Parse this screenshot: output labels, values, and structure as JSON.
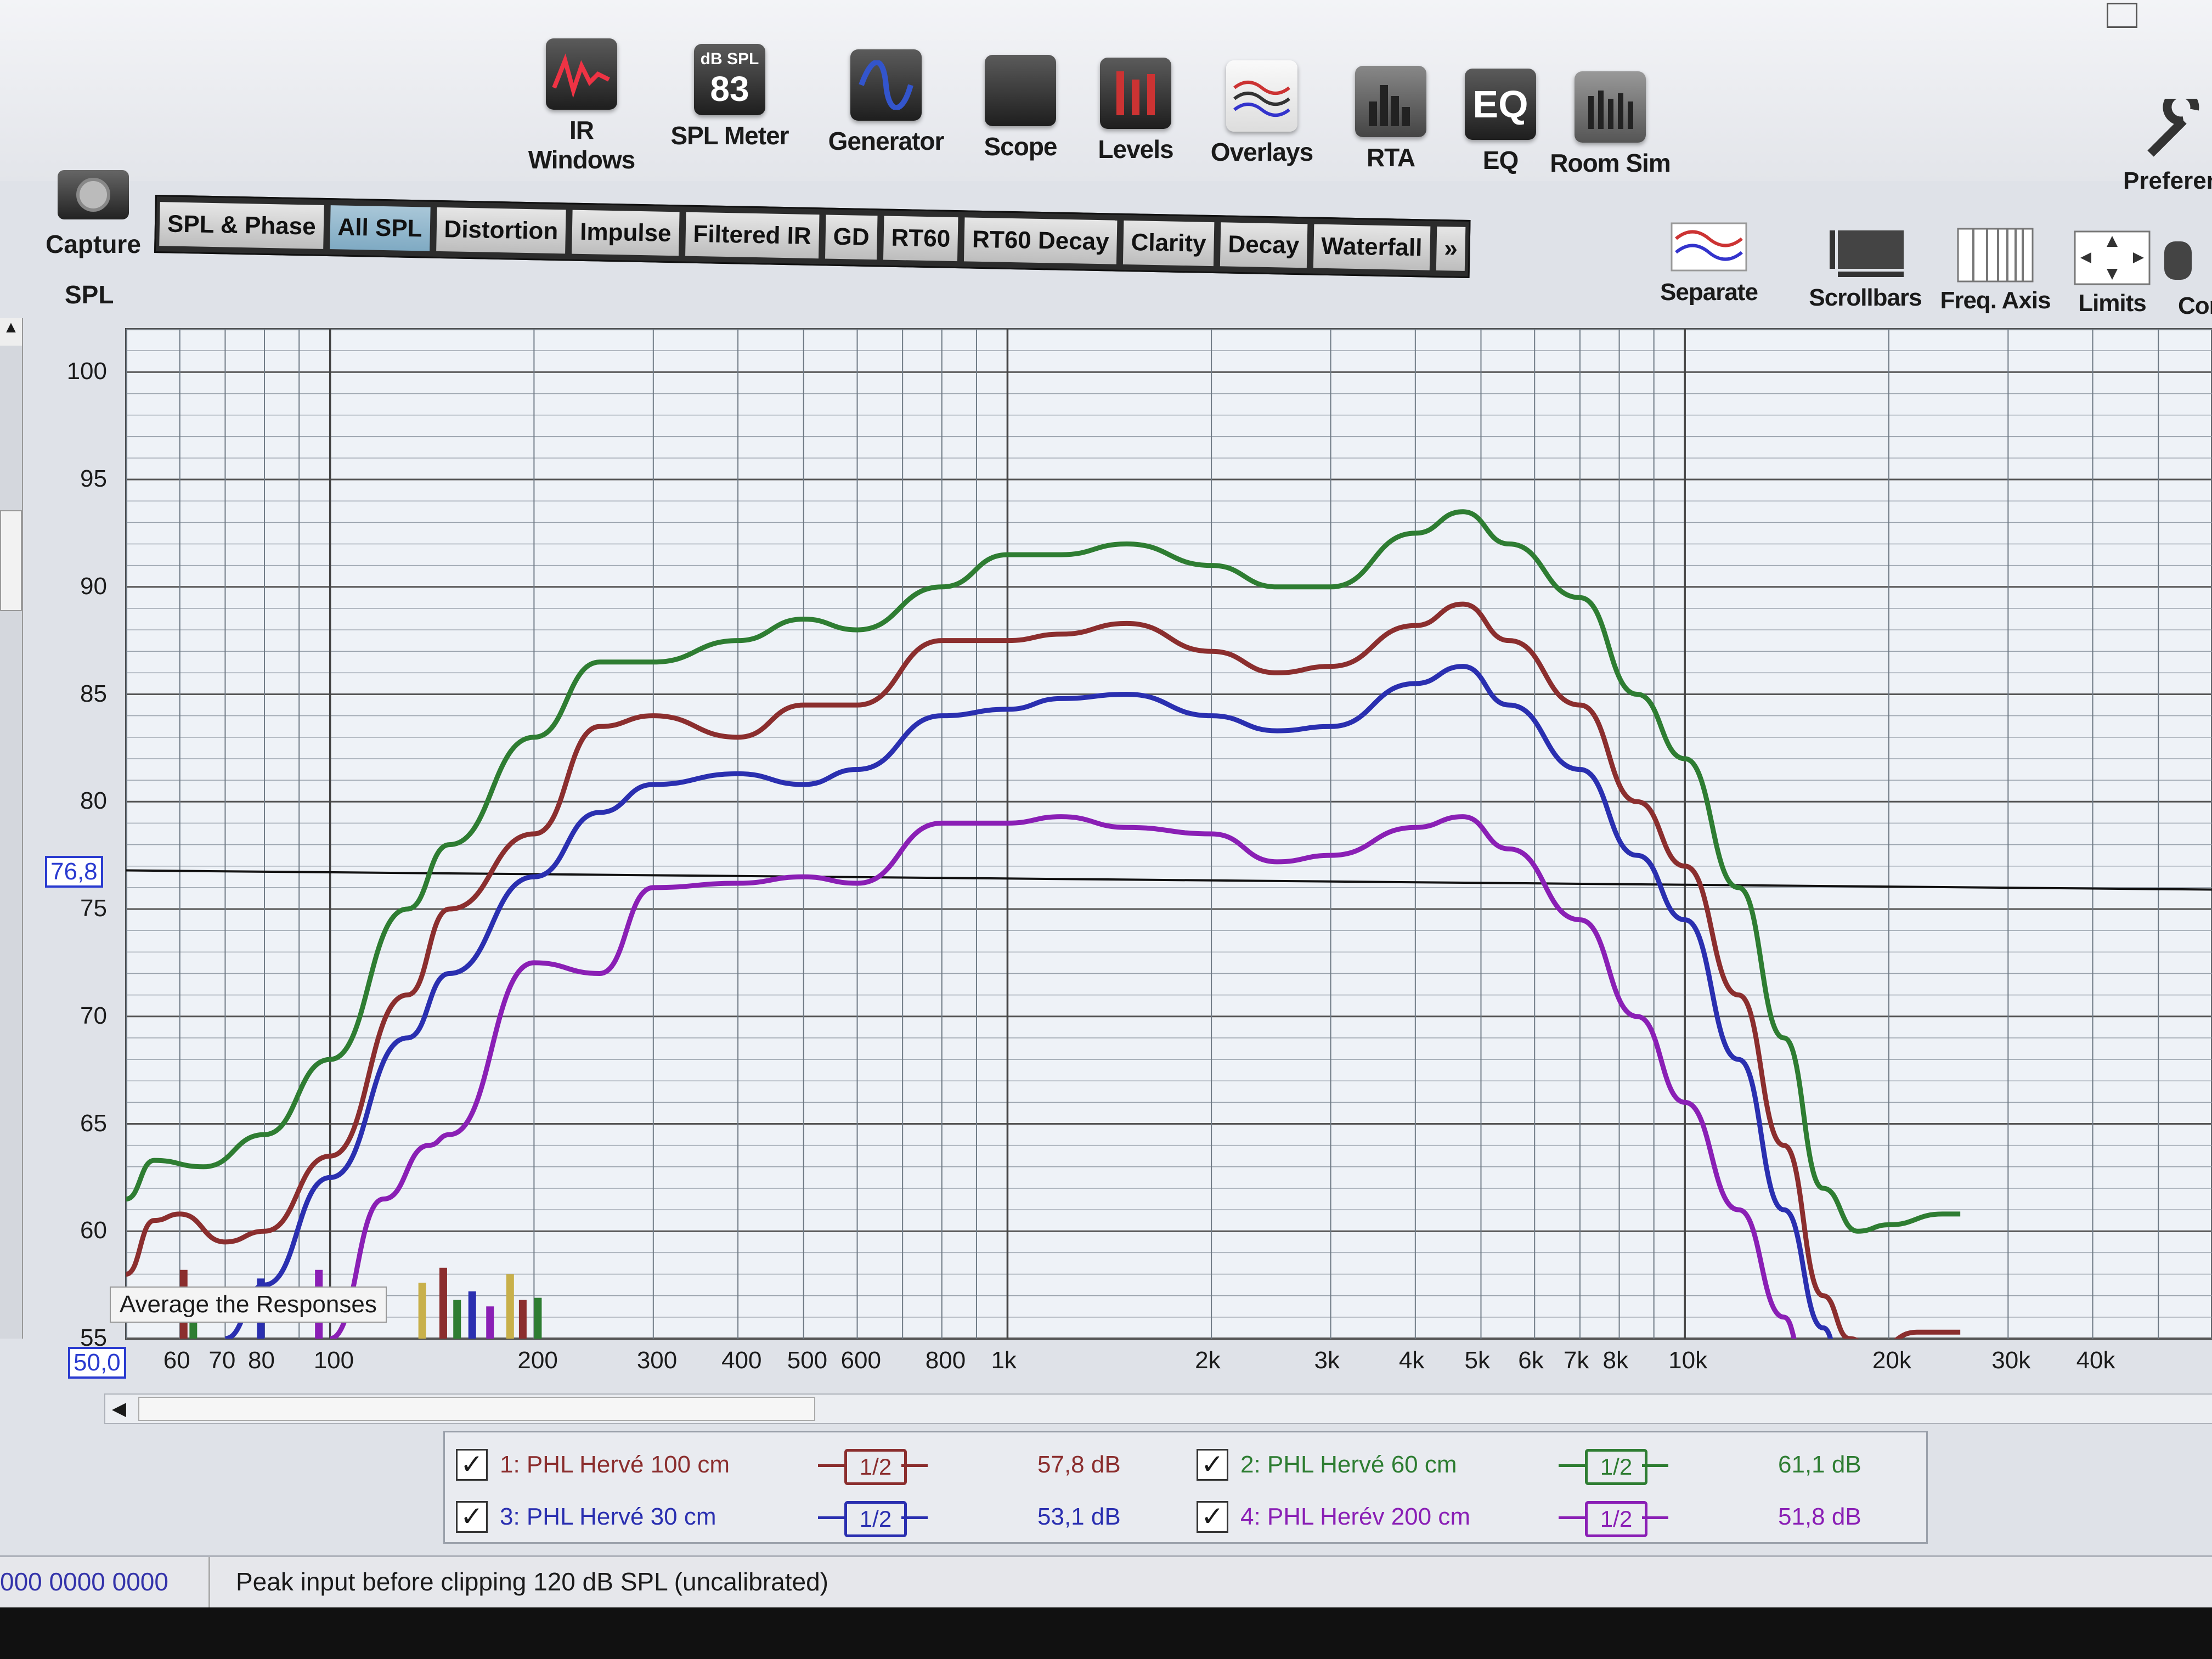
{
  "toolbar": {
    "tools": [
      {
        "label": "IR Windows",
        "icon": "ir-windows-icon"
      },
      {
        "label": "SPL Meter",
        "icon": "spl-meter-icon",
        "meter_top": "dB SPL",
        "meter_value": "83"
      },
      {
        "label": "Generator",
        "icon": "generator-icon"
      },
      {
        "label": "Scope",
        "icon": "scope-icon"
      },
      {
        "label": "Levels",
        "icon": "levels-icon"
      },
      {
        "label": "Overlays",
        "icon": "overlays-icon"
      },
      {
        "label": "RTA",
        "icon": "rta-icon"
      },
      {
        "label": "EQ",
        "icon": "eq-icon",
        "icon_text": "EQ"
      },
      {
        "label": "Room Sim",
        "icon": "room-sim-icon"
      }
    ],
    "capture_label": "Capture",
    "preferences_label": "Preferen"
  },
  "tabs": [
    "SPL & Phase",
    "All SPL",
    "Distortion",
    "Impulse",
    "Filtered IR",
    "GD",
    "RT60",
    "RT60 Decay",
    "Clarity",
    "Decay",
    "Waterfall",
    "»"
  ],
  "active_tab": "All SPL",
  "graph_tools": [
    {
      "label": "Separate",
      "icon": "separate-icon"
    },
    {
      "label": "Scrollbars",
      "icon": "scrollbars-icon"
    },
    {
      "label": "Freq. Axis",
      "icon": "freq-axis-icon"
    },
    {
      "label": "Limits",
      "icon": "limits-icon"
    },
    {
      "label": "Cor",
      "icon": "controls-icon"
    }
  ],
  "graph": {
    "y_axis_title": "SPL",
    "cursor_y": "76,8",
    "cursor_x": "50,0",
    "tooltip": "Average the Responses"
  },
  "chart_data": {
    "type": "line",
    "x_scale": "log",
    "xlim": [
      50,
      50000
    ],
    "ylim": [
      55,
      102
    ],
    "x_ticks": [
      "60",
      "70",
      "80",
      "100",
      "200",
      "300",
      "400",
      "500",
      "600",
      "800",
      "1k",
      "2k",
      "3k",
      "4k",
      "5k",
      "6k",
      "7k",
      "8k",
      "10k",
      "20k",
      "30k",
      "40k"
    ],
    "y_ticks": [
      "100",
      "95",
      "90",
      "85",
      "80",
      "75",
      "70",
      "65",
      "60",
      "55"
    ],
    "grid": true,
    "series": [
      {
        "name": "2: PHL Hervé 60 cm",
        "color": "#2e7d32",
        "points": [
          [
            50,
            61.5
          ],
          [
            55,
            63.3
          ],
          [
            65,
            63
          ],
          [
            80,
            64.5
          ],
          [
            100,
            68
          ],
          [
            130,
            75
          ],
          [
            150,
            78
          ],
          [
            200,
            83
          ],
          [
            250,
            86.5
          ],
          [
            300,
            86.5
          ],
          [
            400,
            87.5
          ],
          [
            500,
            88.5
          ],
          [
            600,
            88
          ],
          [
            800,
            90
          ],
          [
            1000,
            91.5
          ],
          [
            1200,
            91.5
          ],
          [
            1500,
            92
          ],
          [
            2000,
            91
          ],
          [
            2500,
            90
          ],
          [
            3000,
            90
          ],
          [
            4000,
            92.5
          ],
          [
            4700,
            93.5
          ],
          [
            5500,
            92
          ],
          [
            7000,
            89.5
          ],
          [
            8500,
            85
          ],
          [
            10000,
            82
          ],
          [
            12000,
            76
          ],
          [
            14000,
            69
          ],
          [
            16000,
            62
          ],
          [
            18000,
            60
          ],
          [
            20000,
            60.3
          ],
          [
            24000,
            60.8
          ],
          [
            25500,
            60.8
          ]
        ]
      },
      {
        "name": "1: PHL Hervé 100 cm",
        "color": "#8b2e2e",
        "points": [
          [
            50,
            58
          ],
          [
            55,
            60.5
          ],
          [
            60,
            60.8
          ],
          [
            70,
            59.5
          ],
          [
            80,
            60
          ],
          [
            100,
            63.5
          ],
          [
            130,
            71
          ],
          [
            150,
            75
          ],
          [
            200,
            78.5
          ],
          [
            250,
            83.5
          ],
          [
            300,
            84
          ],
          [
            400,
            83
          ],
          [
            500,
            84.5
          ],
          [
            600,
            84.5
          ],
          [
            800,
            87.5
          ],
          [
            1000,
            87.5
          ],
          [
            1200,
            87.8
          ],
          [
            1500,
            88.3
          ],
          [
            2000,
            87
          ],
          [
            2500,
            86
          ],
          [
            3000,
            86.3
          ],
          [
            4000,
            88.2
          ],
          [
            4700,
            89.2
          ],
          [
            5500,
            87.5
          ],
          [
            7000,
            84.5
          ],
          [
            8500,
            80
          ],
          [
            10000,
            77
          ],
          [
            12000,
            71
          ],
          [
            14000,
            64
          ],
          [
            16000,
            57
          ],
          [
            17500,
            55
          ],
          [
            19000,
            54.5
          ],
          [
            22000,
            55.3
          ],
          [
            25500,
            55.3
          ]
        ]
      },
      {
        "name": "3: PHL Hervé 30 cm",
        "color": "#2a2fb0",
        "points": [
          [
            70,
            55
          ],
          [
            80,
            57.5
          ],
          [
            100,
            62.5
          ],
          [
            130,
            69
          ],
          [
            150,
            72
          ],
          [
            200,
            76.5
          ],
          [
            250,
            79.5
          ],
          [
            300,
            80.8
          ],
          [
            400,
            81.3
          ],
          [
            500,
            80.8
          ],
          [
            600,
            81.5
          ],
          [
            800,
            84
          ],
          [
            1000,
            84.3
          ],
          [
            1200,
            84.8
          ],
          [
            1500,
            85
          ],
          [
            2000,
            84
          ],
          [
            2500,
            83.3
          ],
          [
            3000,
            83.5
          ],
          [
            4000,
            85.5
          ],
          [
            4700,
            86.3
          ],
          [
            5500,
            84.5
          ],
          [
            7000,
            81.5
          ],
          [
            8500,
            77.5
          ],
          [
            10000,
            74.5
          ],
          [
            12000,
            68
          ],
          [
            14000,
            61
          ],
          [
            16000,
            55.5
          ],
          [
            17000,
            54
          ]
        ]
      },
      {
        "name": "4: PHL Herév 200 cm",
        "color": "#8a1fb5",
        "points": [
          [
            100,
            55
          ],
          [
            120,
            61.5
          ],
          [
            140,
            64
          ],
          [
            150,
            64.5
          ],
          [
            200,
            72.5
          ],
          [
            250,
            72
          ],
          [
            300,
            76
          ],
          [
            400,
            76.2
          ],
          [
            500,
            76.5
          ],
          [
            600,
            76.2
          ],
          [
            800,
            79
          ],
          [
            1000,
            79
          ],
          [
            1200,
            79.3
          ],
          [
            1500,
            78.8
          ],
          [
            2000,
            78.5
          ],
          [
            2500,
            77.2
          ],
          [
            3000,
            77.5
          ],
          [
            4000,
            78.8
          ],
          [
            4700,
            79.3
          ],
          [
            5500,
            77.8
          ],
          [
            7000,
            74.5
          ],
          [
            8500,
            70
          ],
          [
            10000,
            66
          ],
          [
            12000,
            61
          ],
          [
            14000,
            56
          ],
          [
            15000,
            54
          ]
        ]
      }
    ],
    "horizontal_cursor": 76.8
  },
  "legend": [
    {
      "checked": true,
      "name": "1: PHL Hervé 100 cm",
      "smoothing": "1/2",
      "value": "57,8 dB",
      "color": "#8b2e2e"
    },
    {
      "checked": true,
      "name": "2: PHL Hervé 60 cm",
      "smoothing": "1/2",
      "value": "61,1 dB",
      "color": "#2e7d32"
    },
    {
      "checked": true,
      "name": "3: PHL Hervé 30 cm",
      "smoothing": "1/2",
      "value": "53,1 dB",
      "color": "#2a2fb0"
    },
    {
      "checked": true,
      "name": "4: PHL Herév 200 cm",
      "smoothing": "1/2",
      "value": "51,8 dB",
      "color": "#8a1fb5"
    }
  ],
  "status": {
    "counters": "000  0000 0000",
    "message": "Peak input before clipping 120 dB SPL (uncalibrated)"
  }
}
